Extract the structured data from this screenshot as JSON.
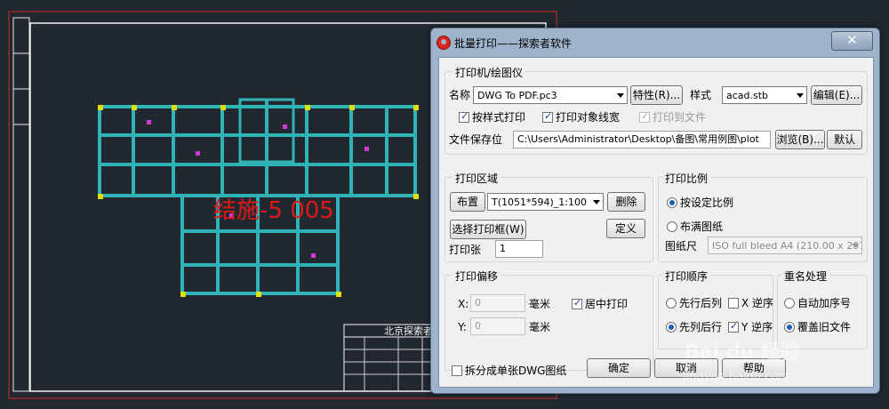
{
  "cad": {
    "drawing_label": "结施-5 005",
    "title_block_text": "北京探索者"
  },
  "dialog": {
    "title": "批量打印——探索者软件",
    "close_glyph": "✕",
    "printer_group": {
      "label": "打印机/绘图仪",
      "name_label": "名称",
      "name_value": "DWG To PDF.pc3",
      "properties_button": "特性(R)...",
      "style_label": "样式",
      "style_value": "acad.stb",
      "edit_button": "编辑(E)...",
      "plot_with_styles": {
        "label": "按样式打印",
        "checked": true
      },
      "plot_lineweights": {
        "label": "打印对象线宽",
        "checked": true
      },
      "plot_to_file": {
        "label": "打印到文件",
        "checked": true,
        "disabled": true
      },
      "save_location_label": "文件保存位",
      "save_location_value": "C:\\Users\\Administrator\\Desktop\\备图\\常用例图\\plot",
      "browse_button": "浏览(B)...",
      "default_button": "默认"
    },
    "plot_area_group": {
      "label": "打印区域",
      "layout_button": "布置",
      "frame_value": "T(1051*594)_1:100",
      "delete_button": "删除",
      "select_frame_button": "选择打印框(W)",
      "define_button": "定义",
      "copies_label": "打印张",
      "copies_value": "1"
    },
    "scale_group": {
      "label": "打印比例",
      "by_scale": {
        "label": "按设定比例",
        "selected": true
      },
      "fit_paper": {
        "label": "布满图纸",
        "selected": false
      },
      "paper_size_label": "图纸尺",
      "paper_size_value": "ISO full bleed A4 (210.00 x 297.0"
    },
    "offset_group": {
      "label": "打印偏移",
      "x_label": "X:",
      "x_value": "0",
      "y_label": "Y:",
      "y_value": "0",
      "unit_x": "毫米",
      "unit_y": "毫米",
      "center_plot": {
        "label": "居中打印",
        "checked": true
      }
    },
    "order_group": {
      "label": "打印顺序",
      "row_first": {
        "label": "先行后列",
        "selected": false
      },
      "x_reverse": {
        "label": "X 逆序",
        "checked": false
      },
      "col_first": {
        "label": "先列后行",
        "selected": true
      },
      "y_reverse": {
        "label": "Y 逆序",
        "checked": true
      }
    },
    "rename_group": {
      "label": "重名处理",
      "auto_number": {
        "label": "自动加序号",
        "selected": false
      },
      "overwrite": {
        "label": "覆盖旧文件",
        "selected": true
      }
    },
    "split_dwg": {
      "label": "拆分成单张DWG图纸",
      "checked": false
    },
    "ok_button": "确定",
    "cancel_button": "取消",
    "help_button": "帮助"
  },
  "watermark": {
    "brand": "Bai du 经验",
    "url": "jingyan.baidu.com"
  }
}
